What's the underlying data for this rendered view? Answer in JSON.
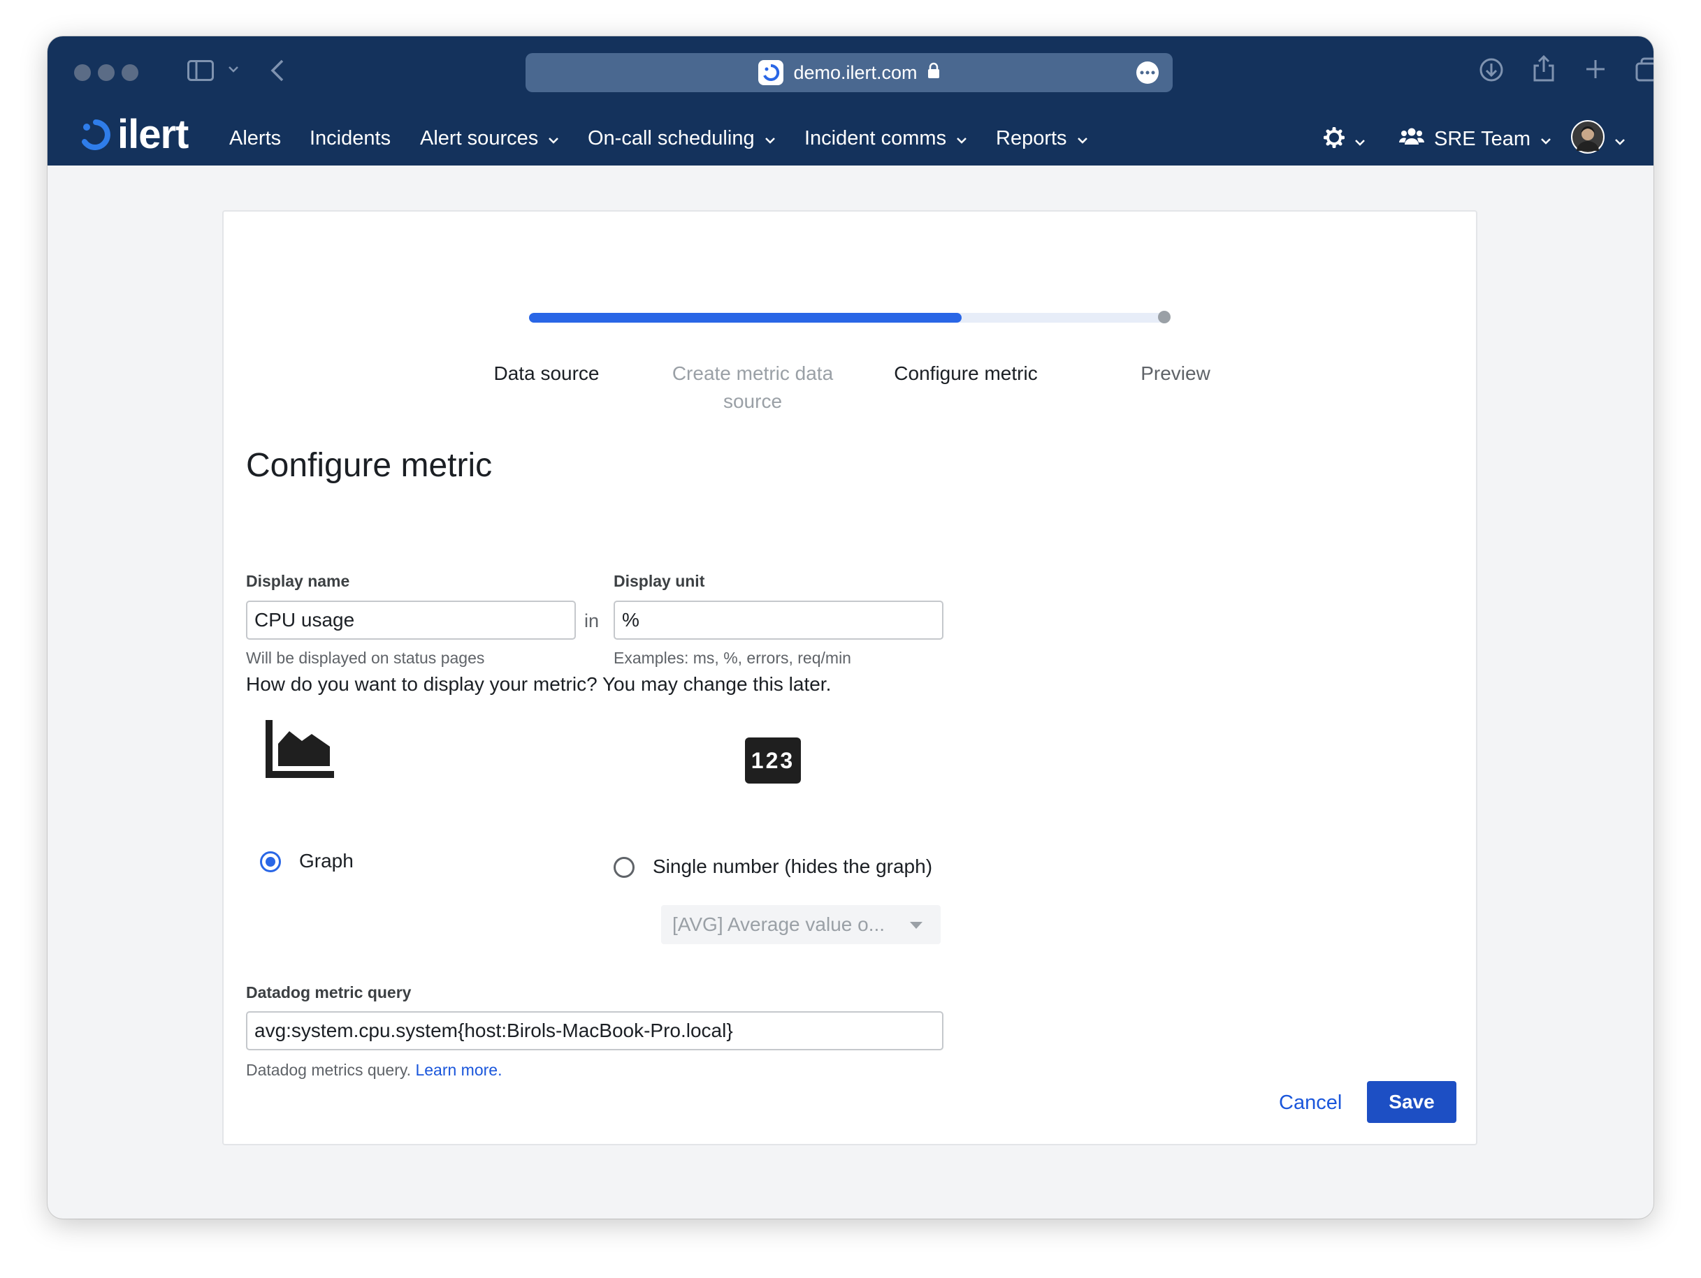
{
  "browser": {
    "url": "demo.ilert.com"
  },
  "app": {
    "logo_text": "ilert",
    "nav": {
      "alerts": "Alerts",
      "incidents": "Incidents",
      "alert_sources": "Alert sources",
      "on_call": "On-call scheduling",
      "incident_comms": "Incident comms",
      "reports": "Reports",
      "team": "SRE Team"
    }
  },
  "stepper": {
    "progress_fraction": 0.68,
    "steps": [
      {
        "label": "Data source",
        "state": "done"
      },
      {
        "label": "Create metric data source",
        "state": "skipped"
      },
      {
        "label": "Configure metric",
        "state": "active"
      },
      {
        "label": "Preview",
        "state": "pending"
      }
    ]
  },
  "form": {
    "title": "Configure metric",
    "display_name": {
      "label": "Display name",
      "value": "CPU usage",
      "help": "Will be displayed on status pages"
    },
    "in_text": "in",
    "display_unit": {
      "label": "Display unit",
      "value": "%",
      "help": "Examples: ms, %, errors, req/min"
    },
    "display_question": "How do you want to display your metric? You may change this later.",
    "options": {
      "graph_label": "Graph",
      "single_label": "Single number (hides the graph)",
      "single_icon_text": "123",
      "aggregation_selected": "[AVG] Average value o..."
    },
    "query": {
      "label": "Datadog metric query",
      "value": "avg:system.cpu.system{host:Birols-MacBook-Pro.local}",
      "help": "Datadog metrics query.",
      "learn_more": "Learn more."
    },
    "cancel_label": "Cancel",
    "save_label": "Save"
  },
  "colors": {
    "header_bg": "#14325c",
    "accent": "#2966e6",
    "primary_button": "#1d4fc4"
  }
}
